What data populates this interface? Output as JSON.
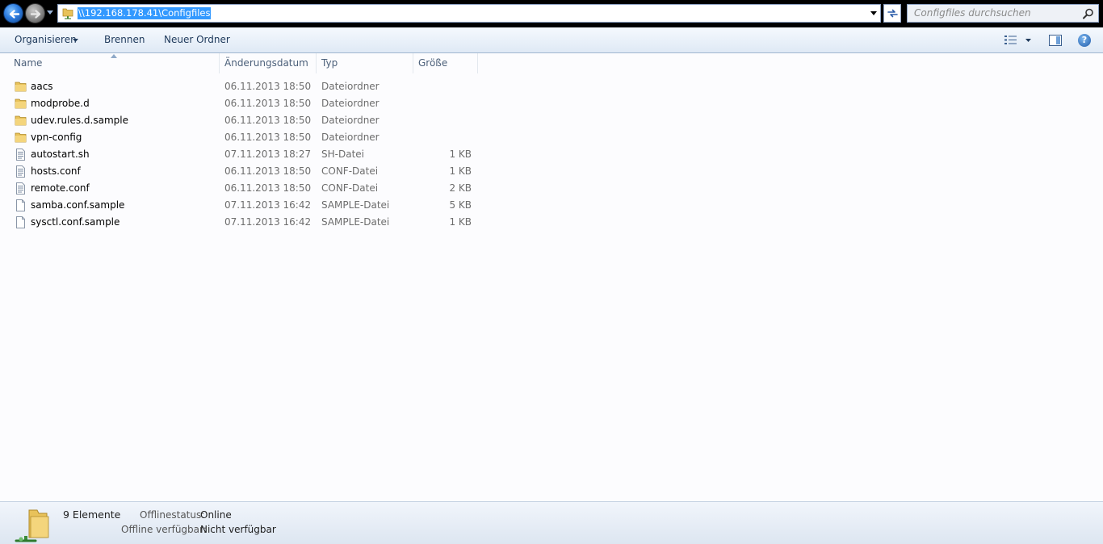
{
  "address_bar": {
    "path": "\\\\192.168.178.41\\Configfiles",
    "search_placeholder": "Configfiles durchsuchen"
  },
  "toolbar": {
    "organize_label": "Organisieren",
    "burn_label": "Brennen",
    "new_folder_label": "Neuer Ordner"
  },
  "columns": {
    "name": "Name",
    "date": "Änderungsdatum",
    "type": "Typ",
    "size": "Größe"
  },
  "files": [
    {
      "name": "aacs",
      "date": "06.11.2013 18:50",
      "type": "Dateiordner",
      "size": "",
      "icon": "folder-icon"
    },
    {
      "name": "modprobe.d",
      "date": "06.11.2013 18:50",
      "type": "Dateiordner",
      "size": "",
      "icon": "folder-icon"
    },
    {
      "name": "udev.rules.d.sample",
      "date": "06.11.2013 18:50",
      "type": "Dateiordner",
      "size": "",
      "icon": "folder-icon"
    },
    {
      "name": "vpn-config",
      "date": "06.11.2013 18:50",
      "type": "Dateiordner",
      "size": "",
      "icon": "folder-icon"
    },
    {
      "name": "autostart.sh",
      "date": "07.11.2013 18:27",
      "type": "SH-Datei",
      "size": "1 KB",
      "icon": "text-file-icon"
    },
    {
      "name": "hosts.conf",
      "date": "06.11.2013 18:50",
      "type": "CONF-Datei",
      "size": "1 KB",
      "icon": "text-file-icon"
    },
    {
      "name": "remote.conf",
      "date": "06.11.2013 18:50",
      "type": "CONF-Datei",
      "size": "2 KB",
      "icon": "text-file-icon"
    },
    {
      "name": "samba.conf.sample",
      "date": "07.11.2013 16:42",
      "type": "SAMPLE-Datei",
      "size": "5 KB",
      "icon": "blank-file-icon"
    },
    {
      "name": "sysctl.conf.sample",
      "date": "07.11.2013 16:42",
      "type": "SAMPLE-Datei",
      "size": "1 KB",
      "icon": "blank-file-icon"
    }
  ],
  "details": {
    "count": "9 Elemente",
    "offline_status_label": "Offlinestatus:",
    "offline_status_value": "Online",
    "offline_available_label": "Offline verfügbar:",
    "offline_available_value": "Nicht verfügbar"
  },
  "colors": {
    "selection": "#3399ff",
    "folder": "#e8c25a",
    "toolbar_text": "#1e395b"
  }
}
